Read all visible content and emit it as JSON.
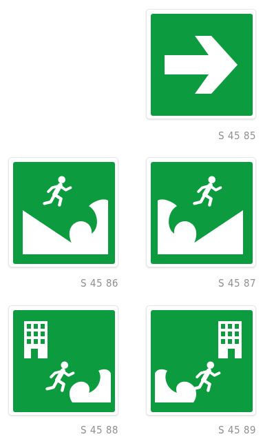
{
  "colors": {
    "sign_green": "#0c9b3e",
    "symbol": "#ffffff",
    "code_text": "#8f8f8f"
  },
  "signs": [
    {
      "code": "S 45 85",
      "icon": "arrow-right-icon"
    },
    {
      "code": "S 45 86",
      "icon": "tsunami-evacuation-uphill-left-icon"
    },
    {
      "code": "S 45 87",
      "icon": "tsunami-evacuation-uphill-right-icon"
    },
    {
      "code": "S 45 88",
      "icon": "tsunami-evacuation-building-left-icon"
    },
    {
      "code": "S 45 89",
      "icon": "tsunami-evacuation-building-right-icon"
    }
  ]
}
